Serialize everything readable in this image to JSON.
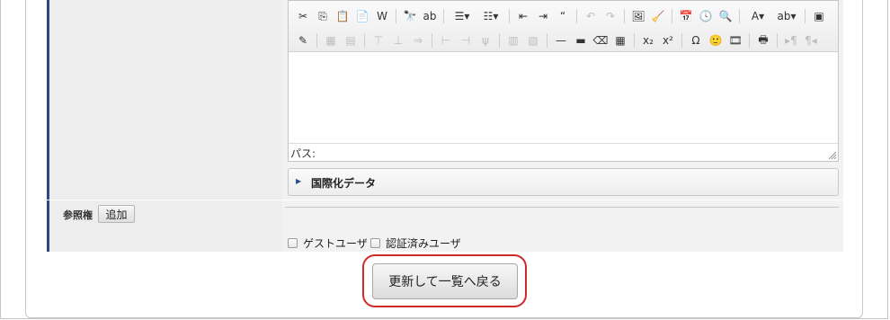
{
  "editor": {
    "toolbar_row1": [
      {
        "name": "cut-icon",
        "glyph": "✂"
      },
      {
        "name": "copy-icon",
        "glyph": "⎘"
      },
      {
        "name": "paste-icon",
        "glyph": "📋"
      },
      {
        "name": "paste-text-icon",
        "glyph": "📄"
      },
      {
        "name": "paste-word-icon",
        "glyph": "W"
      },
      {
        "sep": true
      },
      {
        "name": "find-icon",
        "glyph": "🔭"
      },
      {
        "name": "replace-icon",
        "glyph": "ab"
      },
      {
        "sep": true
      },
      {
        "name": "bullet-list-icon",
        "glyph": "☰▾",
        "wide": true
      },
      {
        "name": "numbered-list-icon",
        "glyph": "☷▾",
        "wide": true
      },
      {
        "sep": true
      },
      {
        "name": "outdent-icon",
        "glyph": "⇤"
      },
      {
        "name": "indent-icon",
        "glyph": "⇥"
      },
      {
        "name": "blockquote-icon",
        "glyph": "“"
      },
      {
        "sep": true
      },
      {
        "name": "undo-icon",
        "glyph": "↶",
        "dim": true
      },
      {
        "name": "redo-icon",
        "glyph": "↷",
        "dim": true
      },
      {
        "sep": true
      },
      {
        "name": "insert-image-icon",
        "glyph": "🖼"
      },
      {
        "name": "cleanup-icon",
        "glyph": "🧹"
      },
      {
        "sep": true
      },
      {
        "name": "insert-date-icon",
        "glyph": "📅"
      },
      {
        "name": "insert-time-icon",
        "glyph": "🕓"
      },
      {
        "name": "preview-icon",
        "glyph": "🔍"
      },
      {
        "sep": true
      },
      {
        "name": "font-color-icon",
        "glyph": "A▾",
        "wide": true
      },
      {
        "name": "highlight-color-icon",
        "glyph": "ab▾",
        "wide": true
      },
      {
        "sep": true
      },
      {
        "name": "fullscreen-icon",
        "glyph": "▣"
      }
    ],
    "toolbar_row2": [
      {
        "name": "edit-css-icon",
        "glyph": "✎"
      },
      {
        "sep": true
      },
      {
        "name": "table-icon",
        "glyph": "▦",
        "dim": true
      },
      {
        "name": "table-props-icon",
        "glyph": "▤",
        "dim": true
      },
      {
        "sep": true
      },
      {
        "name": "row-before-icon",
        "glyph": "⊤",
        "dim": true
      },
      {
        "name": "row-after-icon",
        "glyph": "⊥",
        "dim": true
      },
      {
        "name": "delete-row-icon",
        "glyph": "⇒",
        "dim": true
      },
      {
        "sep": true
      },
      {
        "name": "col-before-icon",
        "glyph": "⊢",
        "dim": true
      },
      {
        "name": "col-after-icon",
        "glyph": "⊣",
        "dim": true
      },
      {
        "name": "delete-col-icon",
        "glyph": "ψ",
        "dim": true
      },
      {
        "sep": true
      },
      {
        "name": "split-cells-icon",
        "glyph": "▥",
        "dim": true
      },
      {
        "name": "merge-cells-icon",
        "glyph": "▧",
        "dim": true
      },
      {
        "sep": true
      },
      {
        "name": "horizontal-rule-icon",
        "glyph": "—"
      },
      {
        "name": "line-icon",
        "glyph": "▬"
      },
      {
        "name": "remove-format-icon",
        "glyph": "⌫"
      },
      {
        "name": "visual-aid-icon",
        "glyph": "▦"
      },
      {
        "sep": true
      },
      {
        "name": "subscript-icon",
        "glyph": "x₂"
      },
      {
        "name": "superscript-icon",
        "glyph": "x²"
      },
      {
        "sep": true
      },
      {
        "name": "special-char-icon",
        "glyph": "Ω"
      },
      {
        "name": "emoticon-icon",
        "glyph": "🙂"
      },
      {
        "name": "media-icon",
        "glyph": "🎞"
      },
      {
        "sep": true
      },
      {
        "name": "print-icon",
        "glyph": "🖶"
      },
      {
        "sep": true
      },
      {
        "name": "ltr-icon",
        "glyph": "▸¶",
        "dim": true
      },
      {
        "name": "rtl-icon",
        "glyph": "¶◂",
        "dim": true
      }
    ],
    "path_label": "パス:"
  },
  "i18n": {
    "label": "国際化データ"
  },
  "permissions": {
    "label": "参照権",
    "add_button": "追加",
    "checkboxes": [
      {
        "label": "ゲストユーザ",
        "checked": false
      },
      {
        "label": "認証済みユーザ",
        "checked": false
      }
    ]
  },
  "submit": {
    "label": "更新して一覧へ戻る"
  },
  "colors": {
    "accent": "#2a4a8a",
    "highlight_ring": "#cf2a2a"
  }
}
